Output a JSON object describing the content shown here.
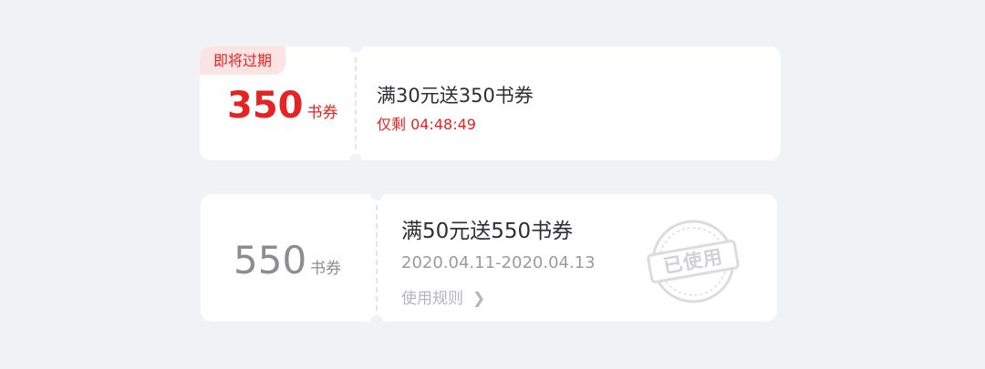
{
  "coupons": [
    {
      "badge": "即将过期",
      "amount": "350",
      "unit": "书券",
      "title": "满30元送350书券",
      "countdown": "仅剩 04:48:49"
    },
    {
      "amount": "550",
      "unit": "书券",
      "title": "满50元送550书券",
      "validity": "2020.04.11-2020.04.13",
      "rules_link": "使用规则",
      "stamp_text": "已使用"
    }
  ],
  "colors": {
    "page_bg": "#f1f2f6",
    "accent_red": "#e62222",
    "badge_bg": "#fde4e4",
    "muted": "#8c8c92"
  },
  "icons": {
    "rules_chevron": "chevron-right-icon",
    "used_stamp": "used-stamp-icon"
  }
}
